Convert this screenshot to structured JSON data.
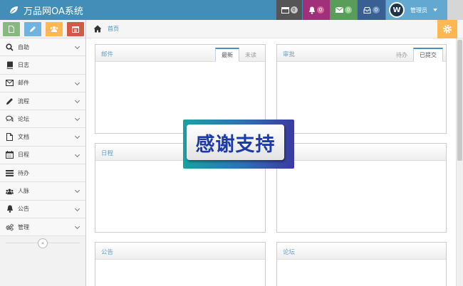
{
  "app": {
    "title": "万品网OA系统"
  },
  "topbar": {
    "notifications": [
      {
        "name": "tasks",
        "count": "0",
        "color": "#555555"
      },
      {
        "name": "bell",
        "count": "0",
        "color": "#a0307a"
      },
      {
        "name": "mail",
        "count": "0",
        "color": "#5a9d5a"
      },
      {
        "name": "inbox",
        "count": "0",
        "color": "#3a5f93"
      }
    ],
    "user": {
      "name": "管理员",
      "avatar_letter": "W"
    }
  },
  "sidebar": {
    "shortcuts": [
      {
        "icon": "document-icon",
        "color": "#87b87f"
      },
      {
        "icon": "pencil-icon",
        "color": "#6fb3e0"
      },
      {
        "icon": "group-icon",
        "color": "#ffb752"
      },
      {
        "icon": "calendar-icon",
        "color": "#d15b47"
      }
    ],
    "items": [
      {
        "label": "自助",
        "icon": "search-icon",
        "has_children": true
      },
      {
        "label": "日志",
        "icon": "book-icon",
        "has_children": false
      },
      {
        "label": "邮件",
        "icon": "envelope-icon",
        "has_children": true
      },
      {
        "label": "流程",
        "icon": "pencil-icon",
        "has_children": true
      },
      {
        "label": "论坛",
        "icon": "comments-icon",
        "has_children": true
      },
      {
        "label": "文档",
        "icon": "file-icon",
        "has_children": true
      },
      {
        "label": "日程",
        "icon": "calendar-icon",
        "has_children": true
      },
      {
        "label": "待办",
        "icon": "list-icon",
        "has_children": false
      },
      {
        "label": "人脉",
        "icon": "users-icon",
        "has_children": true
      },
      {
        "label": "公告",
        "icon": "bell-icon",
        "has_children": true
      },
      {
        "label": "管理",
        "icon": "cogs-icon",
        "has_children": true
      }
    ],
    "collapse_glyph": "«"
  },
  "breadcrumb": {
    "home": "首页"
  },
  "widgets": {
    "mail": {
      "title": "邮件",
      "tabs": [
        "最新",
        "未读"
      ],
      "active_tab": 0
    },
    "approval": {
      "title": "审批",
      "tabs": [
        "待办",
        "已提交"
      ],
      "active_tab": 1
    },
    "schedule": {
      "title": "日程"
    },
    "blank": {
      "title": ""
    },
    "notice": {
      "title": "公告"
    },
    "forum": {
      "title": "论坛"
    }
  },
  "overlay": {
    "text": "感谢支持"
  }
}
